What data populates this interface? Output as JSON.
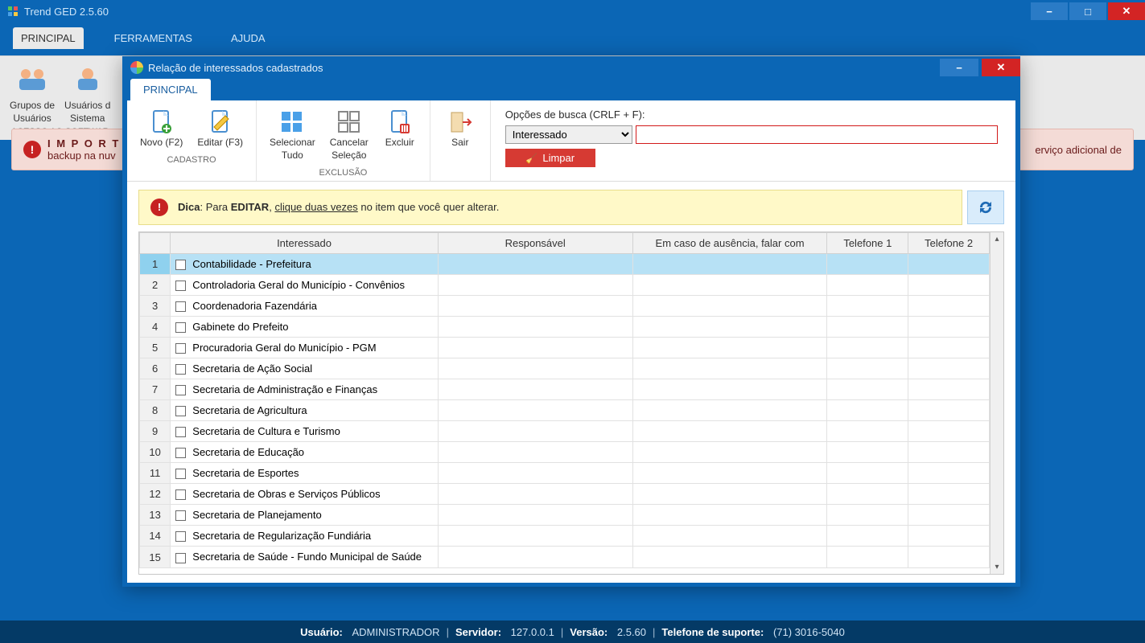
{
  "window": {
    "title": "Trend GED 2.5.60",
    "tabs": [
      "PRINCIPAL",
      "FERRAMENTAS",
      "AJUDA"
    ],
    "active_tab": "PRINCIPAL"
  },
  "main_ribbon": {
    "btn1_line1": "Grupos de",
    "btn1_line2": "Usuários",
    "btn2_line1": "Usuários d",
    "btn2_line2": "Sistema",
    "group_name": "ACESSO AO SOFTWAR"
  },
  "important_bar": {
    "title": "I M P O R T A",
    "line2": "backup na nuv",
    "tail": "erviço adicional de"
  },
  "dialog": {
    "title": "Relação de interessados cadastrados",
    "tab": "PRINCIPAL",
    "ribbon": {
      "novo": "Novo (F2)",
      "editar": "Editar (F3)",
      "grp_cadastro": "CADASTRO",
      "sel_tudo_l1": "Selecionar",
      "sel_tudo_l2": "Tudo",
      "canc_l1": "Cancelar",
      "canc_l2": "Seleção",
      "excluir": "Excluir",
      "grp_exclusao": "EXCLUSÃO",
      "sair": "Sair"
    },
    "search": {
      "label": "Opções de busca (CRLF + F):",
      "field": "Interessado",
      "value": "",
      "clear": "Limpar"
    },
    "tip": {
      "prefix": "Dica",
      "text1": ": Para ",
      "bold": "EDITAR",
      "text2": ", ",
      "link": "clique duas vezes",
      "text3": " no item que você quer alterar."
    },
    "columns": [
      "Interessado",
      "Responsável",
      "Em caso de ausência, falar com",
      "Telefone 1",
      "Telefone 2"
    ],
    "rows": [
      {
        "n": "1",
        "interessado": "Contabilidade - Prefeitura",
        "resp": "",
        "aus": "",
        "t1": "",
        "t2": "",
        "selected": true
      },
      {
        "n": "2",
        "interessado": "Controladoria Geral do Município - Convênios",
        "resp": "",
        "aus": "",
        "t1": "",
        "t2": ""
      },
      {
        "n": "3",
        "interessado": "Coordenadoria Fazendária",
        "resp": "",
        "aus": "",
        "t1": "",
        "t2": ""
      },
      {
        "n": "4",
        "interessado": "Gabinete do Prefeito",
        "resp": "",
        "aus": "",
        "t1": "",
        "t2": ""
      },
      {
        "n": "5",
        "interessado": "Procuradoria Geral do Município - PGM",
        "resp": "",
        "aus": "",
        "t1": "",
        "t2": ""
      },
      {
        "n": "6",
        "interessado": "Secretaria de Ação Social",
        "resp": "",
        "aus": "",
        "t1": "",
        "t2": ""
      },
      {
        "n": "7",
        "interessado": "Secretaria de Administração e Finanças",
        "resp": "",
        "aus": "",
        "t1": "",
        "t2": ""
      },
      {
        "n": "8",
        "interessado": "Secretaria de Agricultura",
        "resp": "",
        "aus": "",
        "t1": "",
        "t2": ""
      },
      {
        "n": "9",
        "interessado": "Secretaria de Cultura e Turismo",
        "resp": "",
        "aus": "",
        "t1": "",
        "t2": ""
      },
      {
        "n": "10",
        "interessado": "Secretaria de Educação",
        "resp": "",
        "aus": "",
        "t1": "",
        "t2": ""
      },
      {
        "n": "11",
        "interessado": "Secretaria de Esportes",
        "resp": "",
        "aus": "",
        "t1": "",
        "t2": ""
      },
      {
        "n": "12",
        "interessado": "Secretaria de Obras e Serviços Públicos",
        "resp": "",
        "aus": "",
        "t1": "",
        "t2": ""
      },
      {
        "n": "13",
        "interessado": "Secretaria de Planejamento",
        "resp": "",
        "aus": "",
        "t1": "",
        "t2": ""
      },
      {
        "n": "14",
        "interessado": "Secretaria de Regularização Fundiária",
        "resp": "",
        "aus": "",
        "t1": "",
        "t2": ""
      },
      {
        "n": "15",
        "interessado": "Secretaria de Saúde - Fundo Municipal de Saúde",
        "resp": "",
        "aus": "",
        "t1": "",
        "t2": ""
      }
    ]
  },
  "status": {
    "usuario_lbl": "Usuário:",
    "usuario": "ADMINISTRADOR",
    "servidor_lbl": "Servidor:",
    "servidor": "127.0.0.1",
    "versao_lbl": "Versão:",
    "versao": "2.5.60",
    "telefone_lbl": "Telefone de suporte:",
    "telefone": "(71) 3016-5040"
  }
}
